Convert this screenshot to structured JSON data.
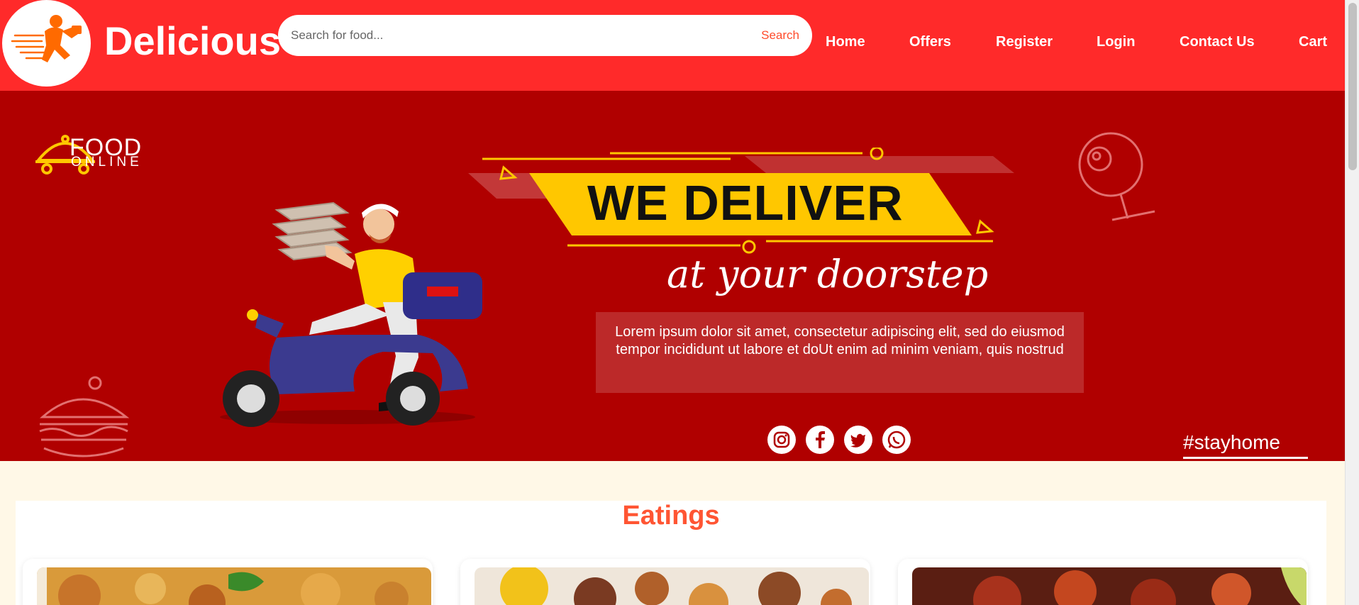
{
  "header": {
    "brand": "Delicious",
    "logo_icon": "delivery-runner-icon",
    "search": {
      "placeholder": "Search for food...",
      "value": "",
      "button_label": "Search"
    },
    "nav": [
      {
        "label": "Home"
      },
      {
        "label": "Offers"
      },
      {
        "label": "Register"
      },
      {
        "label": "Login"
      },
      {
        "label": "Contact Us"
      },
      {
        "label": "Cart"
      }
    ]
  },
  "banner": {
    "logo_line1": "FOOD",
    "logo_line2": "ONLINE",
    "headline": "WE DELIVER",
    "tagline": "at your doorstep",
    "description": "Lorem ipsum dolor sit amet, consectetur adipiscing elit, sed do eiusmod tempor incididunt ut labore et doUt enim ad minim veniam, quis nostrud",
    "social": [
      "instagram-icon",
      "facebook-icon",
      "twitter-icon",
      "whatsapp-icon"
    ],
    "hashtag": "#stayhome"
  },
  "section": {
    "title": "Eatings",
    "cards": [
      {
        "image": "biryani-photo"
      },
      {
        "image": "grilled-chicken-photo"
      },
      {
        "image": "tandoori-chicken-photo"
      }
    ]
  },
  "colors": {
    "navbar": "#ff2a2a",
    "banner": "#b00000",
    "accent": "#ff5533",
    "headline_band": "#ffc700",
    "page_bg": "#fff8e7"
  }
}
